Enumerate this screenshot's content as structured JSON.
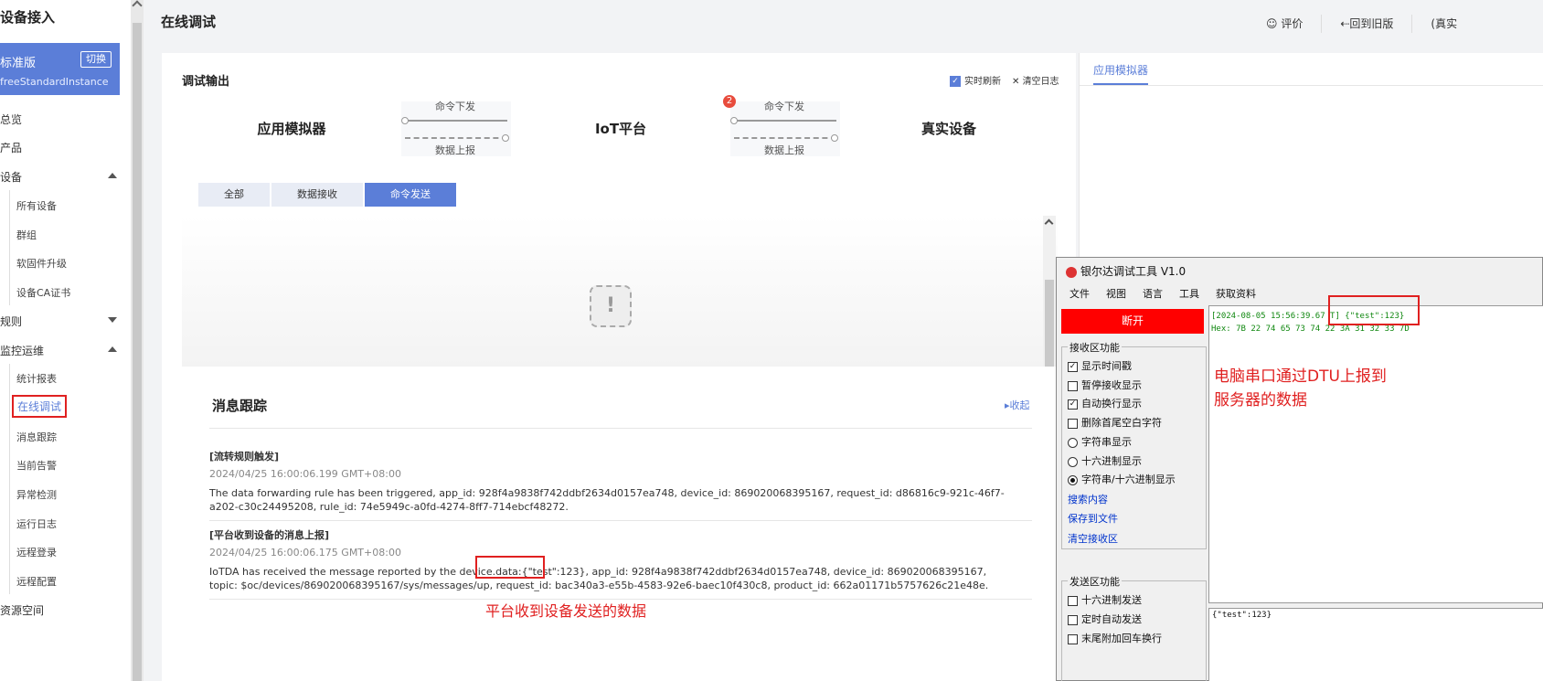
{
  "sidebar": {
    "title": "设备接入",
    "edition": {
      "name": "标准版",
      "switch_label": "切换",
      "instance": "freeStandardInstance"
    },
    "items": [
      {
        "label": "总览"
      },
      {
        "label": "产品"
      },
      {
        "label": "设备"
      },
      {
        "label": "所有设备"
      },
      {
        "label": "群组"
      },
      {
        "label": "软固件升级"
      },
      {
        "label": "设备CA证书"
      },
      {
        "label": "规则"
      },
      {
        "label": "监控运维"
      },
      {
        "label": "统计报表"
      },
      {
        "label": "在线调试"
      },
      {
        "label": "消息跟踪"
      },
      {
        "label": "当前告警"
      },
      {
        "label": "异常检测"
      },
      {
        "label": "运行日志"
      },
      {
        "label": "远程登录"
      },
      {
        "label": "远程配置"
      },
      {
        "label": "资源空间"
      }
    ]
  },
  "header": {
    "title": "在线调试",
    "rate_label": "☺ 评价",
    "back_old_label": "⇠回到旧版",
    "truncated_label": "(真实"
  },
  "debug": {
    "title": "调试输出",
    "realtime_label": "实时刷新",
    "clear_log_label": "清空日志",
    "flow": {
      "app_simulator": "应用模拟器",
      "iot_platform": "IoT平台",
      "real_device": "真实设备",
      "cmd_down": "命令下发",
      "data_up": "数据上报",
      "badge_count": "2"
    },
    "tabs": [
      {
        "label": "全部"
      },
      {
        "label": "数据接收"
      },
      {
        "label": "命令发送"
      }
    ],
    "empty_icon": "!"
  },
  "trace": {
    "title": "消息跟踪",
    "collapse_label": "▸收起",
    "events": [
      {
        "type": "[流转规则触发]",
        "time": "2024/04/25 16:00:06.199 GMT+08:00",
        "message": "The data forwarding rule has been triggered, app_id: 928f4a9838f742ddbf2634d0157ea748, device_id: 869020068395167, request_id: d86816c9-921c-46f7-a202-c30c24495208, rule_id: 74e5949c-a0fd-4274-8ff7-714ebcf48272."
      },
      {
        "type": "[平台收到设备的消息上报]",
        "time": "2024/04/25 16:00:06.175 GMT+08:00",
        "message": "IoTDA has received the message reported by the device.data:{\"test\":123}, app_id: 928f4a9838f742ddbf2634d0157ea748, device_id: 869020068395167, topic: $oc/devices/869020068395167/sys/messages/up, request_id: bac340a3-e55b-4583-92e6-baec10f430c8, product_id: 662a01171b5757626c21e48e."
      }
    ],
    "annotation": "平台收到设备发送的数据"
  },
  "simulator": {
    "tab_label": "应用模拟器"
  },
  "serial_tool": {
    "title": "银尔达调试工具 V1.0",
    "menu": [
      "文件",
      "视图",
      "语言",
      "工具",
      "获取资料"
    ],
    "disconnect_label": "断开",
    "recv_group": {
      "title": "接收区功能",
      "options": [
        {
          "label": "显示时间戳",
          "checked": true
        },
        {
          "label": "暂停接收显示",
          "checked": false
        },
        {
          "label": "自动换行显示",
          "checked": true
        },
        {
          "label": "删除首尾空白字符",
          "checked": false
        }
      ],
      "radios": [
        {
          "label": "字符串显示",
          "selected": false
        },
        {
          "label": "十六进制显示",
          "selected": false
        },
        {
          "label": "字符串/十六进制显示",
          "selected": true
        }
      ],
      "links": [
        "搜索内容",
        "保存到文件",
        "清空接收区"
      ]
    },
    "send_group": {
      "title": "发送区功能",
      "options": [
        {
          "label": "十六进制发送",
          "checked": false
        },
        {
          "label": "定时自动发送",
          "checked": false
        },
        {
          "label": "末尾附加回车换行",
          "checked": false
        }
      ]
    },
    "recv_line1": "[2024-08-05 15:56:39.67  T] {\"test\":123}",
    "recv_line2": "Hex: 7B 22 74 65 73 74 22 3A 31 32 33 7D",
    "annotation_line1": "电脑串口通过DTU上报到",
    "annotation_line2": "服务器的数据",
    "send_text": "{\"test\":123}"
  },
  "colors": {
    "accent": "#5b7ed8",
    "highlight_red": "#e02020",
    "button_red": "#ff0000"
  }
}
